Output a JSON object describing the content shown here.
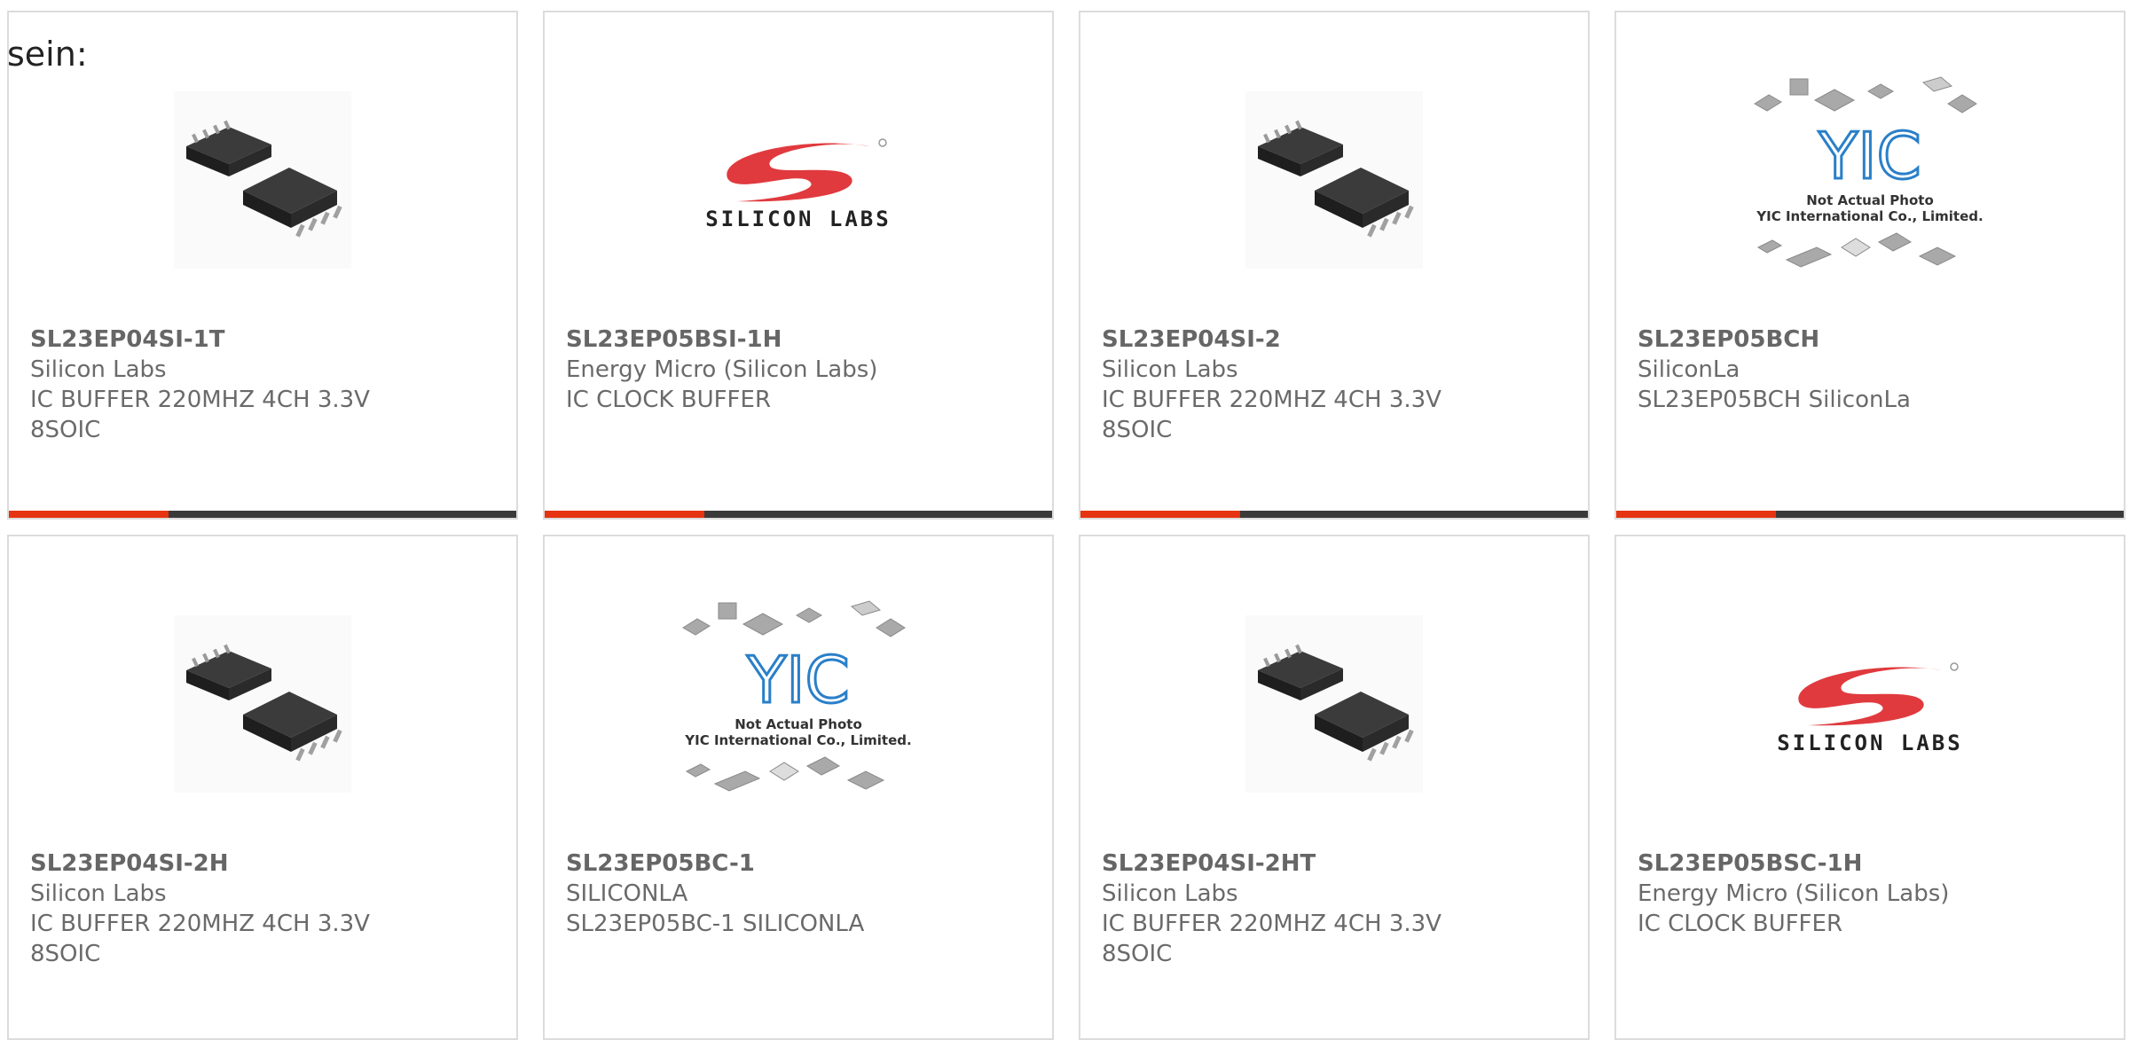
{
  "intro_text": "sein:",
  "colors": {
    "accent": "#e63312",
    "bar": "#3a3a3a",
    "brand_red": "#e03a3e",
    "yic_blue": "#2a7fc9"
  },
  "products": [
    {
      "part": "SL23EP04SI-1T",
      "maker": "Silicon Labs",
      "desc1": "IC BUFFER 220MHZ 4CH 3.3V",
      "desc2": "8SOIC",
      "image": "soic-chip"
    },
    {
      "part": "SL23EP05BSI-1H",
      "maker": "Energy Micro (Silicon Labs)",
      "desc1": "IC CLOCK BUFFER",
      "desc2": "",
      "image": "silicon-labs-logo"
    },
    {
      "part": "SL23EP04SI-2",
      "maker": "Silicon Labs",
      "desc1": "IC BUFFER 220MHZ 4CH 3.3V",
      "desc2": "8SOIC",
      "image": "soic-chip"
    },
    {
      "part": "SL23EP05BCH",
      "maker": "SiliconLa",
      "desc1": "SL23EP05BCH SiliconLa",
      "desc2": "",
      "image": "yic-placeholder"
    },
    {
      "part": "SL23EP04SI-2H",
      "maker": "Silicon Labs",
      "desc1": "IC BUFFER 220MHZ 4CH 3.3V",
      "desc2": "8SOIC",
      "image": "soic-chip"
    },
    {
      "part": "SL23EP05BC-1",
      "maker": "SILICONLA",
      "desc1": "SL23EP05BC-1 SILICONLA",
      "desc2": "",
      "image": "yic-placeholder"
    },
    {
      "part": "SL23EP04SI-2HT",
      "maker": "Silicon Labs",
      "desc1": "IC BUFFER 220MHZ 4CH 3.3V",
      "desc2": "8SOIC",
      "image": "soic-chip"
    },
    {
      "part": "SL23EP05BSC-1H",
      "maker": "Energy Micro (Silicon Labs)",
      "desc1": "IC CLOCK BUFFER",
      "desc2": "",
      "image": "silicon-labs-logo"
    }
  ],
  "image_text": {
    "silicon_labs": "SILICON LABS",
    "yic_logo": "YIC",
    "yic_note1": "Not Actual Photo",
    "yic_note2": "YIC International Co., Limited."
  }
}
